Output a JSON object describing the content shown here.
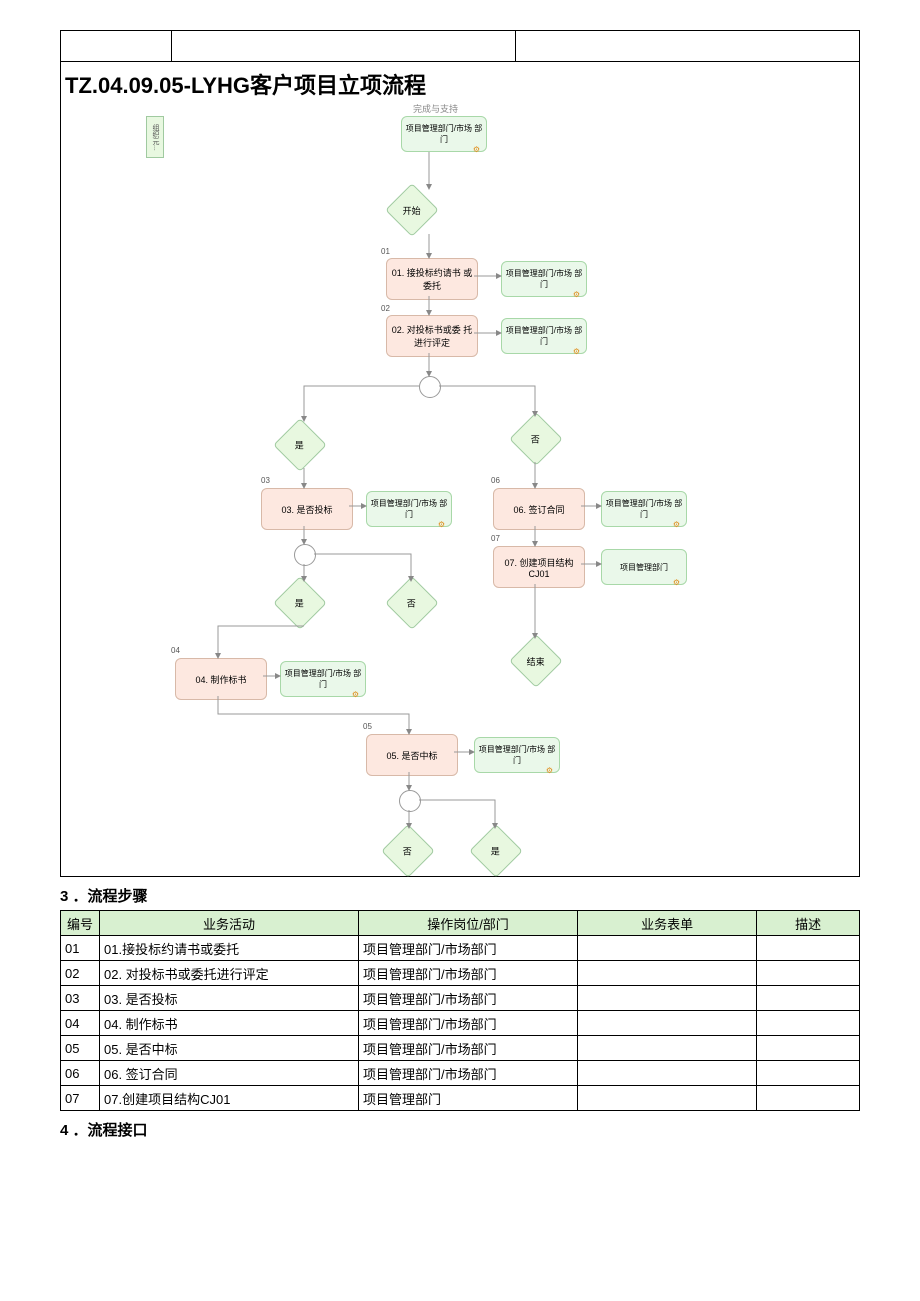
{
  "diagram": {
    "title": "TZ.04.09.05-LYHG客户项目立项流程",
    "system_header": "完成与支持",
    "swim_label": "组织元...",
    "nodes": {
      "start": "开始",
      "end": "结束",
      "n01_num": "01",
      "n01": "01. 接投标约请书\n或委托",
      "n02_num": "02",
      "n02": "02. 对投标书或委\n托进行评定",
      "n03_num": "03",
      "n03": "03. 是否投标",
      "n04_num": "04",
      "n04": "04. 制作标书",
      "n05_num": "05",
      "n05": "05. 是否中标",
      "n06_num": "06",
      "n06": "06. 签订合同",
      "n07_num": "07",
      "n07": "07. 创建项目结构\nCJ01",
      "role_pm_mkt": "项目管理部门/市场\n部门",
      "role_pm": "项目管理部门",
      "yes": "是",
      "no": "否"
    }
  },
  "section3": {
    "num": "3",
    "title": "．流程步骤"
  },
  "section4": {
    "num": "4",
    "title": "．流程接口"
  },
  "table": {
    "headers": {
      "no": "编号",
      "activity": "业务活动",
      "dept": "操作岗位/部门",
      "form": "业务表单",
      "desc": "描述"
    },
    "rows": [
      {
        "no": "01",
        "act": "01.接投标约请书或委托",
        "dept": "项目管理部门/市场部门",
        "form": "",
        "desc": ""
      },
      {
        "no": "02",
        "act": "02. 对投标书或委托进行评定",
        "dept": "项目管理部门/市场部门",
        "form": "",
        "desc": ""
      },
      {
        "no": "03",
        "act": "03. 是否投标",
        "dept": "项目管理部门/市场部门",
        "form": "",
        "desc": ""
      },
      {
        "no": "04",
        "act": "04. 制作标书",
        "dept": "项目管理部门/市场部门",
        "form": "",
        "desc": ""
      },
      {
        "no": "05",
        "act": "05. 是否中标",
        "dept": "项目管理部门/市场部门",
        "form": "",
        "desc": ""
      },
      {
        "no": "06",
        "act": "06. 签订合同",
        "dept": "项目管理部门/市场部门",
        "form": "",
        "desc": ""
      },
      {
        "no": "07",
        "act": "07.创建项目结构CJ01",
        "dept": "项目管理部门",
        "form": "",
        "desc": ""
      }
    ]
  }
}
